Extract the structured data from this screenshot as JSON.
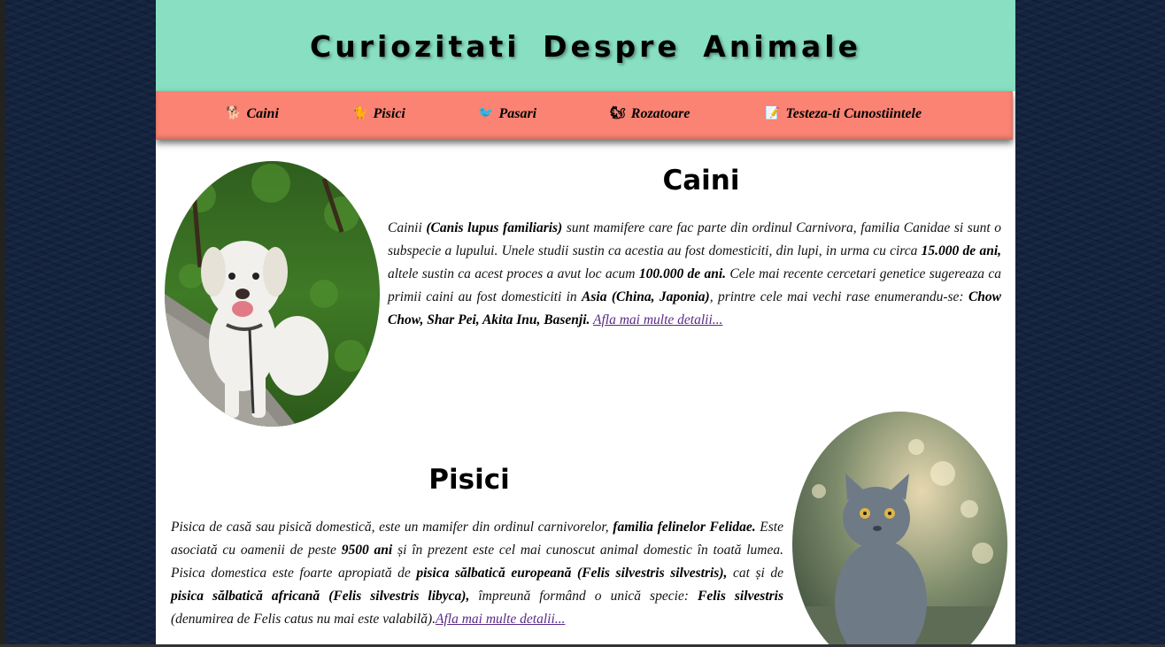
{
  "header": {
    "title": "Curiozitati Despre Animale"
  },
  "nav": [
    {
      "icon": "dog-icon",
      "glyph": "🐕",
      "label": "Caini"
    },
    {
      "icon": "cat-icon",
      "glyph": "🐈",
      "label": "Pisici"
    },
    {
      "icon": "bird-icon",
      "glyph": "🐦",
      "label": "Pasari"
    },
    {
      "icon": "squirrel-icon",
      "glyph": "🐿",
      "label": "Rozatoare"
    },
    {
      "icon": "quiz-icon",
      "glyph": "📝",
      "label": "Testeza-ti Cunostiintele"
    }
  ],
  "caini": {
    "title": "Caini",
    "t1": "Cainii ",
    "b1": "(Canis lupus familiaris)",
    "t2": " sunt mamifere care fac parte din ordinul Carnivora, familia Canidae si sunt o subspecie a lupului. Unele studii sustin ca acestia au fost domesticiti, din lupi, in urma cu circa ",
    "b2": "15.000 de ani,",
    "t3": " altele sustin ca acest proces a avut loc acum ",
    "b3": "100.000 de ani.",
    "t4": " Cele mai recente cercetari genetice sugereaza ca primii caini au fost domesticiti in ",
    "b4": "Asia (China, Japonia)",
    "t5": ", printre cele mai vechi rase enumerandu-se: ",
    "b5": "Chow Chow, Shar Pei, Akita Inu, Basenji.",
    "link": "Afla mai multe detalii..."
  },
  "pisici": {
    "title": "Pisici",
    "t1": "Pisica de casă sau pisică domestică, este un mamifer din ordinul carnivorelor, ",
    "b1": "familia felinelor Felidae.",
    "t2": " Este asociată cu oamenii de peste ",
    "b2": "9500 ani",
    "t3": " și în prezent este cel mai cunoscut animal domestic în toată lumea. Pisica domestica este foarte apropiată de ",
    "b3": "pisica sălbatică europeană (Felis silvestris silvestris),",
    "t4": " cat și de ",
    "b4": "pisica sălbatică africană (Felis silvestris libyca),",
    "t5": " împreună formând o unică specie: ",
    "b5": "Felis silvestris",
    "t6": " (denumirea de Felis catus nu mai este valabilă).",
    "link": "Afla mai multe detalii..."
  },
  "colors": {
    "header_bg": "#88dfc2",
    "nav_bg": "#fa8373",
    "page_bg": "#14233f",
    "link": "#5b2a86"
  }
}
